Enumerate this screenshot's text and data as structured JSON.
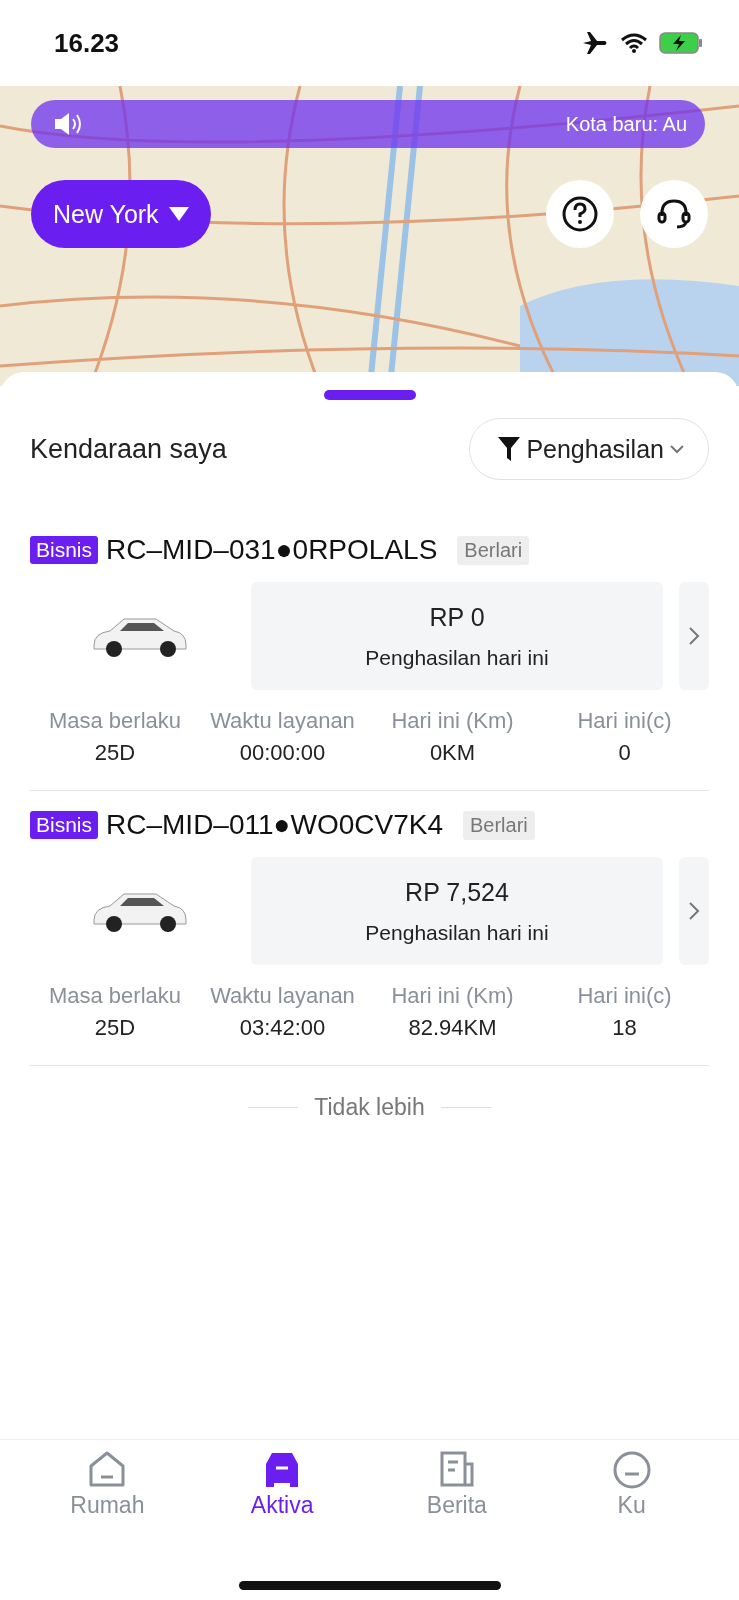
{
  "status_bar": {
    "time": "16.23"
  },
  "map": {
    "banner": "Kota baru: Au",
    "city": "New York"
  },
  "sheet": {
    "title": "Kendaraan saya",
    "filter": "Penghasilan"
  },
  "vehicles": [
    {
      "tag": "Bisnis",
      "plate": "RC–MID–031●0RPOLALS",
      "status": "Berlari",
      "amount": "RP 0",
      "amount_label": "Penghasilan hari ini",
      "stats": [
        {
          "label": "Masa berlaku",
          "value": "25D"
        },
        {
          "label": "Waktu layanan",
          "value": "00:00:00"
        },
        {
          "label": "Hari ini (Km)",
          "value": "0KM"
        },
        {
          "label": "Hari ini(c)",
          "value": "0"
        }
      ]
    },
    {
      "tag": "Bisnis",
      "plate": "RC–MID–011●WO0CV7K4",
      "status": "Berlari",
      "amount": "RP 7,524",
      "amount_label": "Penghasilan hari ini",
      "stats": [
        {
          "label": "Masa berlaku",
          "value": "25D"
        },
        {
          "label": "Waktu layanan",
          "value": "03:42:00"
        },
        {
          "label": "Hari ini (Km)",
          "value": "82.94KM"
        },
        {
          "label": "Hari ini(c)",
          "value": "18"
        }
      ]
    }
  ],
  "end_note": "Tidak lebih",
  "tabs": [
    {
      "label": "Rumah",
      "kind": "home",
      "selected": false
    },
    {
      "label": "Aktiva",
      "kind": "car",
      "selected": true
    },
    {
      "label": "Berita",
      "kind": "news",
      "selected": false
    },
    {
      "label": "Ku",
      "kind": "me",
      "selected": false
    }
  ]
}
